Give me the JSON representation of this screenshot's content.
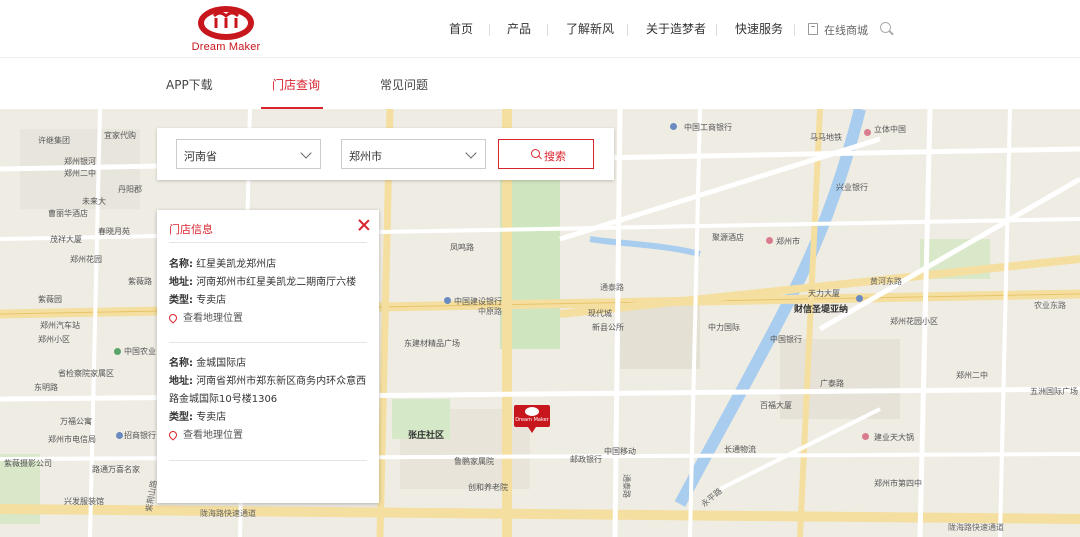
{
  "brand": {
    "logo_text": "Dream Maker",
    "accent": "#d9242e"
  },
  "nav": {
    "items": [
      "首页",
      "产品",
      "了解新风",
      "关于造梦者",
      "快速服务"
    ],
    "mall": "在线商城"
  },
  "subnav": {
    "items": [
      "APP下载",
      "门店查询",
      "常见问题"
    ],
    "active": "门店查询"
  },
  "search": {
    "province": "河南省",
    "city": "郑州市",
    "button": "搜索"
  },
  "info_panel": {
    "title": "门店信息",
    "labels": {
      "name": "名称:",
      "address": "地址:",
      "type": "类型:"
    },
    "stores": [
      {
        "name": "红星美凯龙郑州店",
        "address": "河南郑州市红星美凯龙二期南厅六楼",
        "type": "专卖店",
        "location_link": "查看地理位置"
      },
      {
        "name": "金城国际店",
        "address": "河南省郑州市郑东新区商务内环众意西路金城国际10号楼1306",
        "type": "专卖店",
        "location_link": "查看地理位置"
      }
    ]
  },
  "marker": {
    "label": "Dream Maker"
  },
  "map": {
    "labels": [
      "许继集团",
      "宜家代购",
      "郑州银河",
      "郑州二中",
      "丹阳郡",
      "未来大",
      "曹丽华酒店",
      "茂祥大厦",
      "春晓月苑",
      "郑州花园",
      "紫薇园",
      "郑州汽车站",
      "郑州小区",
      "中国农业",
      "省检察院家属区",
      "东明路",
      "万福公寓",
      "郑州市电信局",
      "招商银行",
      "紫薇摄影公司",
      "路通万喜名家",
      "兴发服装馆",
      "紫荆山路",
      "张庄社区",
      "鲁鹏家属院",
      "创和养老院",
      "陇海路快速通道",
      "紫薇路",
      "东建材精品广场",
      "中国建设银行",
      "凤鸣路",
      "中国工商银行",
      "马马地铁",
      "立体中国",
      "兴业银行",
      "聚源酒店",
      "郑州市",
      "黄河东路",
      "财信圣堤亚纳",
      "中原路",
      "郑州花园小区",
      "农业东路",
      "中国银行",
      "五洲国际广场",
      "郑州二中",
      "建业天大锅",
      "郑州市第四中",
      "陇海路快速通道",
      "永平路",
      "天力大厦",
      "通泰路",
      "新县公所",
      "现代城",
      "中力国际",
      "广泰路",
      "百福大厦",
      "中国移动",
      "长通物流",
      "邮政银行",
      "通泰路"
    ]
  }
}
